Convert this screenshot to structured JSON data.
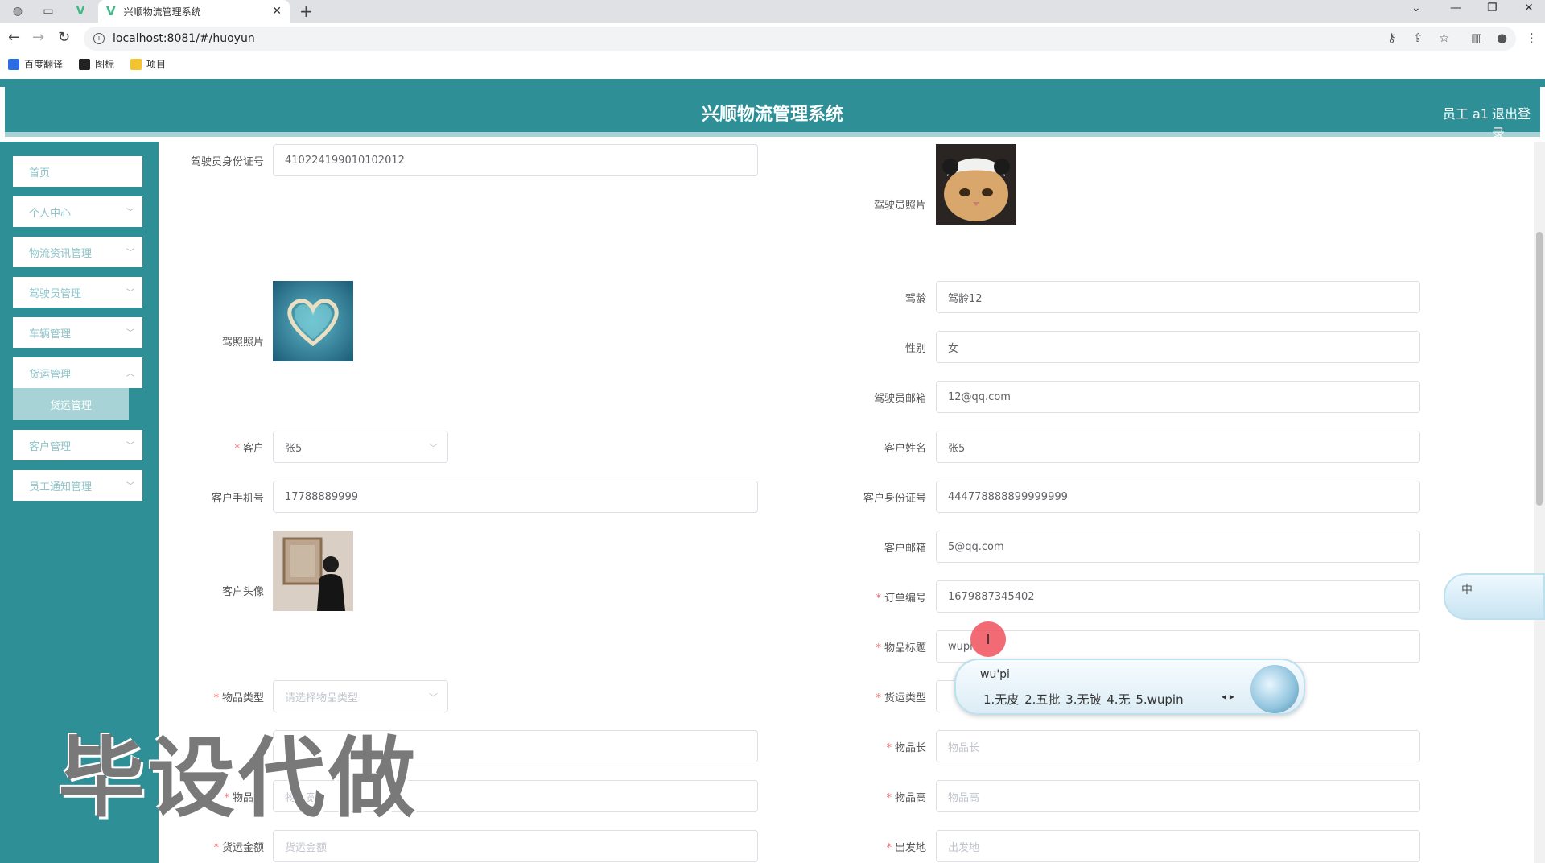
{
  "browser": {
    "tab_title": "兴顺物流管理系统",
    "new_tab": "+",
    "url": "localhost:8081/#/huoyun",
    "bookmarks": [
      {
        "label": "百度翻译",
        "color": "#2b6de5"
      },
      {
        "label": "图标",
        "color": "#222222"
      },
      {
        "label": "项目",
        "color": "#f4c430"
      }
    ]
  },
  "header": {
    "title": "兴顺物流管理系统",
    "user": "员工 a1",
    "logout": "退出登录"
  },
  "sidebar": {
    "items": [
      {
        "label": "首页"
      },
      {
        "label": "个人中心"
      },
      {
        "label": "物流资讯管理"
      },
      {
        "label": "驾驶员管理"
      },
      {
        "label": "车辆管理"
      },
      {
        "label": "货运管理"
      },
      {
        "label": "客户管理"
      },
      {
        "label": "员工通知管理"
      }
    ],
    "active_sub": "货运管理"
  },
  "form": {
    "driver_id": {
      "label": "驾驶员身份证号",
      "value": "410224199010102012"
    },
    "driver_photo": {
      "label": "驾驶员照片"
    },
    "license_photo": {
      "label": "驾照照片"
    },
    "driving_age": {
      "label": "驾龄",
      "value": "驾龄12"
    },
    "gender": {
      "label": "性别",
      "value": "女"
    },
    "driver_email": {
      "label": "驾驶员邮箱",
      "value": "12@qq.com"
    },
    "customer": {
      "label": "客户",
      "value": "张5"
    },
    "customer_name": {
      "label": "客户姓名",
      "value": "张5"
    },
    "customer_phone": {
      "label": "客户手机号",
      "value": "17788889999"
    },
    "customer_id": {
      "label": "客户身份证号",
      "value": "444778888899999999"
    },
    "customer_avatar": {
      "label": "客户头像"
    },
    "customer_email": {
      "label": "客户邮箱",
      "value": "5@qq.com"
    },
    "order_no": {
      "label": "订单编号",
      "value": "1679887345402"
    },
    "item_title": {
      "label": "物品标题",
      "value": "wupi"
    },
    "item_type": {
      "label": "物品类型",
      "placeholder": "请选择物品类型"
    },
    "freight_type": {
      "label": "货运类型"
    },
    "item_length": {
      "label": "物品长",
      "placeholder": "物品长"
    },
    "item_width": {
      "label": "物品宽",
      "placeholder": "物品宽"
    },
    "item_height": {
      "label": "物品高",
      "placeholder": "物品高"
    },
    "freight_amount": {
      "label": "货运金额",
      "placeholder": "货运金额"
    },
    "origin": {
      "label": "出发地",
      "placeholder": "出发地"
    }
  },
  "ime": {
    "composition": "wu'pi",
    "candidates": "1.无皮  2.五批  3.无铍  4.无  5.wupin",
    "status_label": "中"
  },
  "watermark": "毕设代做",
  "colors": {
    "primary": "#2e8f96",
    "light": "#a7d3d6",
    "required": "#f56c6c"
  }
}
